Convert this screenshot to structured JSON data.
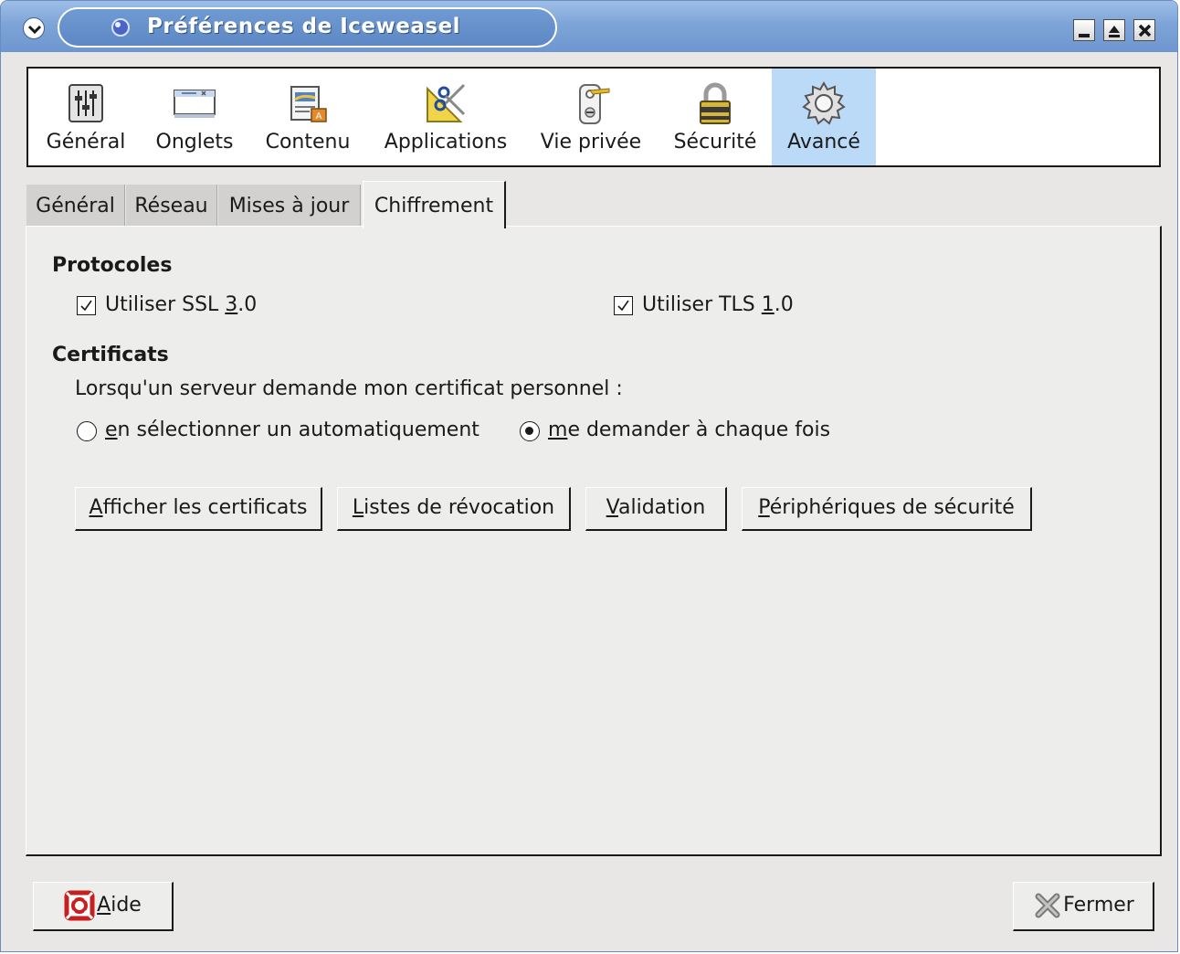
{
  "window": {
    "title": "Préférences de Iceweasel"
  },
  "panes": [
    {
      "label": "Général",
      "icon": "sliders-icon",
      "selected": false
    },
    {
      "label": "Onglets",
      "icon": "window-tabs-icon",
      "selected": false
    },
    {
      "label": "Contenu",
      "icon": "content-icon",
      "selected": false
    },
    {
      "label": "Applications",
      "icon": "applications-icon",
      "selected": false
    },
    {
      "label": "Vie privée",
      "icon": "door-hanger-icon",
      "selected": false
    },
    {
      "label": "Sécurité",
      "icon": "padlock-icon",
      "selected": false
    },
    {
      "label": "Avancé",
      "icon": "gear-icon",
      "selected": true
    }
  ],
  "subtabs": [
    {
      "label": "Général",
      "active": false
    },
    {
      "label": "Réseau",
      "active": false
    },
    {
      "label": "Mises à jour",
      "active": false
    },
    {
      "label": "Chiffrement",
      "active": true
    }
  ],
  "protocols": {
    "heading": "Protocoles",
    "ssl": {
      "pre": "Utiliser SSL ",
      "key": "3",
      "post": ".0",
      "checked": true
    },
    "tls": {
      "pre": "Utiliser TLS ",
      "key": "1",
      "post": ".0",
      "checked": true
    }
  },
  "certificates": {
    "heading": "Certificats",
    "prompt": "Lorsqu'un serveur demande mon certificat personnel :",
    "radio_auto": {
      "key": "e",
      "rest": "n sélectionner un automatiquement",
      "selected": false
    },
    "radio_ask": {
      "key": "m",
      "rest": "e demander à chaque fois",
      "selected": true
    },
    "buttons": [
      {
        "key": "A",
        "rest": "fficher les certificats"
      },
      {
        "key": "L",
        "rest": "istes de révocation"
      },
      {
        "key": "V",
        "rest": "alidation"
      },
      {
        "key": "P",
        "rest": "ériphériques de sécurité"
      }
    ]
  },
  "footer": {
    "help": {
      "key": "A",
      "rest": "ide",
      "icon": "lifebuoy-icon"
    },
    "close": {
      "label": "Fermer",
      "icon": "close-x-icon"
    }
  },
  "colors": {
    "titlebar": "#7ea5d8",
    "selected_pane": "#bbdaf7",
    "dialog_bg": "#e8e7e6"
  }
}
